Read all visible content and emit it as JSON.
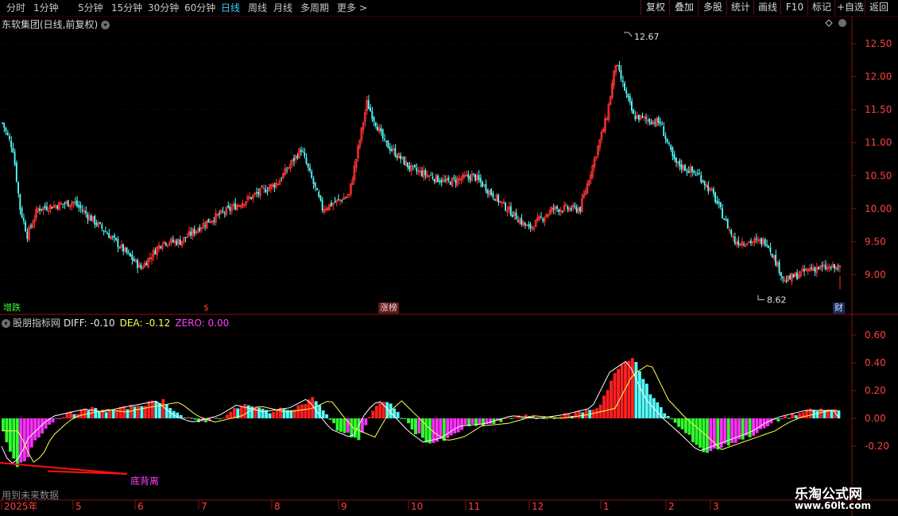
{
  "toolbar": {
    "periods": [
      "分时",
      "1分钟",
      "5分钟",
      "15分钟",
      "30分钟",
      "60分钟",
      "日线",
      "周线",
      "月线",
      "多周期",
      "更多 >"
    ],
    "active_period": "日线",
    "right_buttons": [
      "复权",
      "叠加",
      "多股",
      "统计",
      "画线",
      "F10",
      "标记",
      "+自选",
      "返回"
    ]
  },
  "chart_header": {
    "title": "东软集团(日线,前复权)"
  },
  "main_chart": {
    "y_ticks": [
      "12.50",
      "12.00",
      "11.50",
      "11.00",
      "10.50",
      "10.00",
      "9.50",
      "9.00"
    ],
    "high_label": "12.67",
    "low_label": "8.62",
    "badges": {
      "left": "增跌",
      "mid1": "$",
      "mid2": "涨榜",
      "right": "财"
    }
  },
  "indicator": {
    "name": "股朋指标网",
    "diff": "DIFF: -0.10",
    "dea": "DEA: -0.12",
    "zero": "ZERO: 0.00",
    "y_ticks": [
      "0.60",
      "0.40",
      "0.20",
      "0.00",
      "-0.20"
    ],
    "divergence_label": "底背离",
    "future_note": "用到未来数据"
  },
  "x_axis": {
    "labels": [
      "2025年",
      "5",
      "6",
      "7",
      "8",
      "9",
      "10",
      "11",
      "12",
      "1",
      "2",
      "3"
    ]
  },
  "watermark": {
    "line1": "乐淘公式网",
    "line2": "www.60lt.com"
  },
  "colors": {
    "up": "#ff3232",
    "down": "#54ffff",
    "grid": "#5a0000",
    "macd_pos": "#ff2020",
    "macd_neg_a": "#ff30ff",
    "macd_neg_b": "#30ff30",
    "diff": "#ffffff",
    "dea": "#ffff50"
  }
}
